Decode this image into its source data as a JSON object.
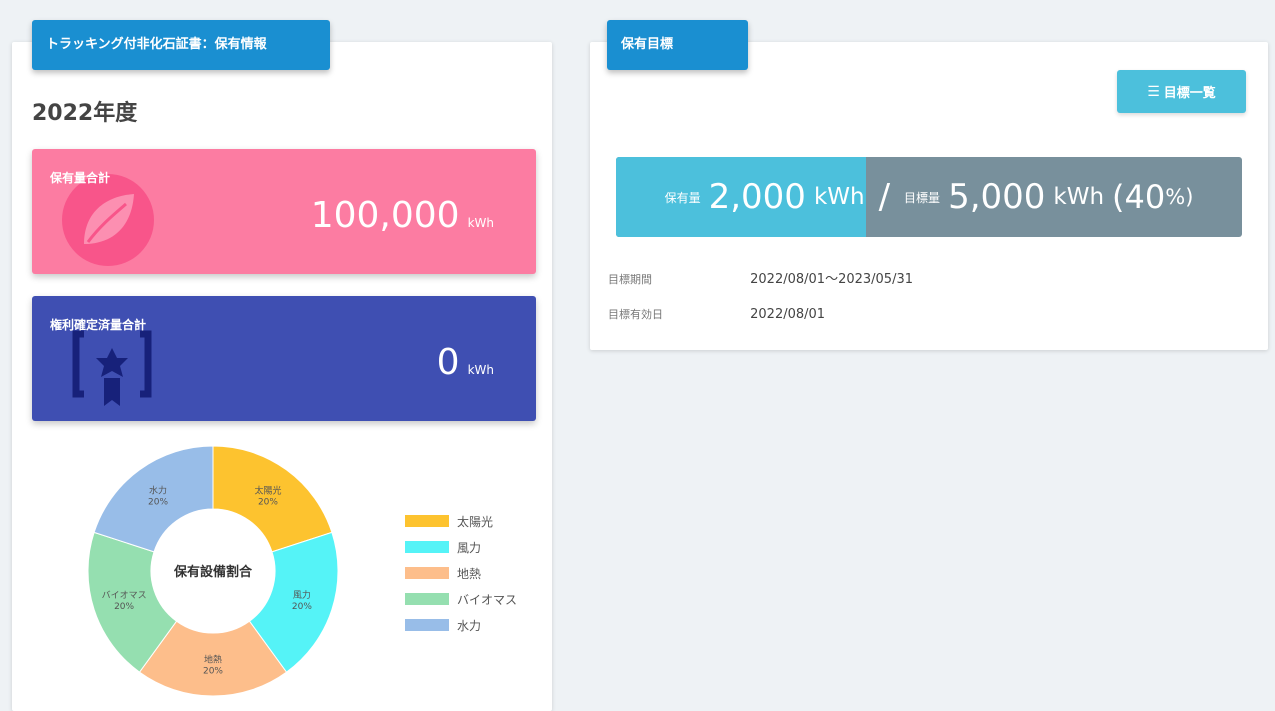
{
  "left_panel": {
    "header": "トラッキング付非化石証書：保有情報",
    "year": "2022年度",
    "holding_total": {
      "label": "保有量合計",
      "value": "100,000",
      "unit": "kWh",
      "icon": "leaf-icon"
    },
    "confirmed_total": {
      "label": "権利確定済量合計",
      "value": "0",
      "unit": "kWh",
      "icon": "certificate-icon"
    },
    "chart": {
      "center_label": "保有設備割合",
      "slices": [
        {
          "name": "太陽光",
          "pct": "20%"
        },
        {
          "name": "風力",
          "pct": "20%"
        },
        {
          "name": "地熱",
          "pct": "20%"
        },
        {
          "name": "バイオマス",
          "pct": "20%"
        },
        {
          "name": "水力",
          "pct": "20%"
        }
      ]
    }
  },
  "chart_data": {
    "type": "pie",
    "categories": [
      "太陽光",
      "風力",
      "地熱",
      "バイオマス",
      "水力"
    ],
    "values": [
      20,
      20,
      20,
      20,
      20
    ],
    "colors": [
      "#fdc32f",
      "#55f3f7",
      "#fdbe8b",
      "#95dfb0",
      "#98bde8"
    ],
    "legend_position": "right"
  },
  "right_panel": {
    "header": "保有目標",
    "list_button": {
      "icon": "list-icon",
      "label": "目標一覧"
    },
    "progress": {
      "held_label": "保有量",
      "held_value": "2,000",
      "held_unit": "kWh",
      "separator": "/",
      "target_label": "目標量",
      "target_value": "5,000",
      "target_unit": "kWh",
      "percent": "(40",
      "percent_sign": "%)",
      "fraction": 0.4
    },
    "period": {
      "label": "目標期間",
      "value": "2022/08/01～2023/05/31"
    },
    "effective": {
      "label": "目標有効日",
      "value": "2022/08/01"
    }
  },
  "colors": {
    "header_blue": "#1a8fd1",
    "pink": "#fc7ca2",
    "indigo": "#3f4fb2",
    "cyan": "#4cc0dc",
    "slate": "#78909c"
  }
}
